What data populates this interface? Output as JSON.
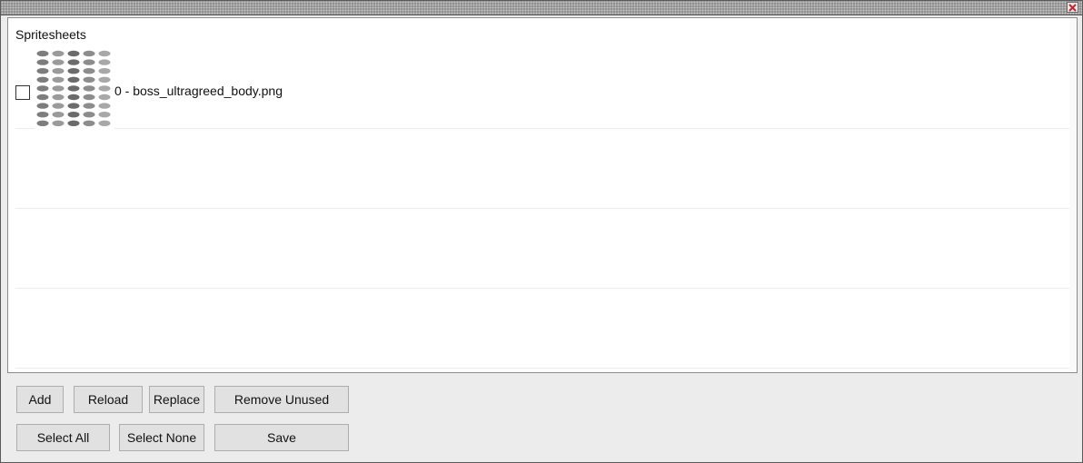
{
  "panel": {
    "title": "Spritesheets",
    "items": [
      {
        "label": "0 - boss_ultragreed_body.png",
        "checked": false
      }
    ]
  },
  "buttons": {
    "add": "Add",
    "reload": "Reload",
    "replace": "Replace",
    "remove_unused": "Remove Unused",
    "select_all": "Select All",
    "select_none": "Select None",
    "save": "Save"
  },
  "icons": {
    "close": "close-icon",
    "thumbnail": "spritesheet-thumbnail-icon",
    "checkbox": "checkbox-icon"
  },
  "colors": {
    "window_bg": "#ececec",
    "panel_bg": "#ffffff",
    "button_bg": "#e1e1e1",
    "close_x": "#c0282d"
  }
}
